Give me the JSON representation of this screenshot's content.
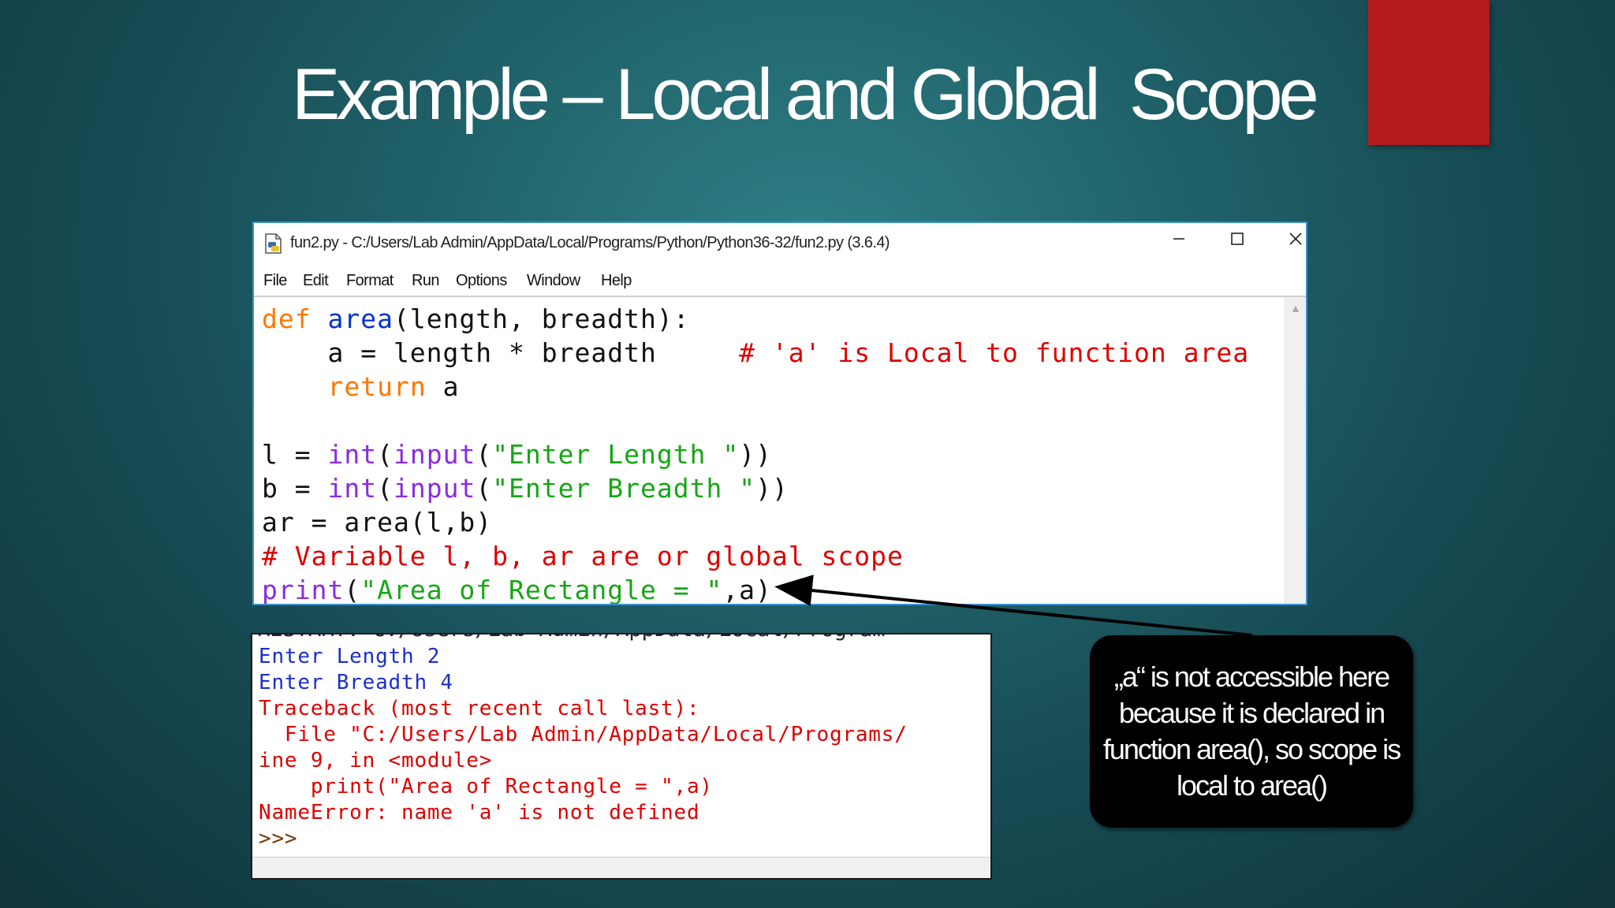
{
  "slide": {
    "title": "Example – Local and Global  Scope",
    "accent_color": "#b4191c"
  },
  "editor": {
    "title": "fun2.py - C:/Users/Lab Admin/AppData/Local/Programs/Python/Python36-32/fun2.py (3.6.4)",
    "icon": "python-file-icon",
    "window_buttons": {
      "minimize": "—",
      "maximize": "☐",
      "close": "✕"
    },
    "menu": [
      "File",
      "Edit",
      "Format",
      "Run",
      "Options",
      "Window",
      "Help"
    ],
    "code": {
      "l1": {
        "kw": "def",
        "fn": "area",
        "rest": "(length, breadth):"
      },
      "l2": {
        "code": "    a = length * breadth     ",
        "comment": "# 'a' is Local to function area"
      },
      "l3": {
        "indent": "    ",
        "kw": "return",
        "rest": " a"
      },
      "l5": {
        "pre": "l = ",
        "bi1": "int",
        "p1": "(",
        "bi2": "input",
        "p2": "(",
        "str": "\"Enter Length \"",
        "post": "))"
      },
      "l6": {
        "pre": "b = ",
        "bi1": "int",
        "p1": "(",
        "bi2": "input",
        "p2": "(",
        "str": "\"Enter Breadth \"",
        "post": "))"
      },
      "l7": "ar = area(l,b)",
      "l8": "# Variable l, b, ar are or global scope",
      "l9": {
        "bi": "print",
        "p": "(",
        "str": "\"Area of Rectangle = \"",
        "post": ",a)"
      }
    },
    "colors": {
      "keyword": "#ff7700",
      "builtin": "#8a2be2",
      "string": "#15a615",
      "comment": "#dd0000",
      "defname": "#0033cc"
    }
  },
  "shell": {
    "cutoff": "RESTART: C:/Users/Lab Admin/AppData/Local/Program",
    "lines": [
      "Enter Length 2",
      "Enter Breadth 4",
      "Traceback (most recent call last):",
      "  File \"C:/Users/Lab Admin/AppData/Local/Programs/",
      "ine 9, in <module>",
      "    print(\"Area of Rectangle = \",a)",
      "NameError: name 'a' is not defined",
      ">>>"
    ]
  },
  "callout": {
    "text": "„a“ is not accessible here because it is declared in function area(), so scope is local to area()"
  }
}
